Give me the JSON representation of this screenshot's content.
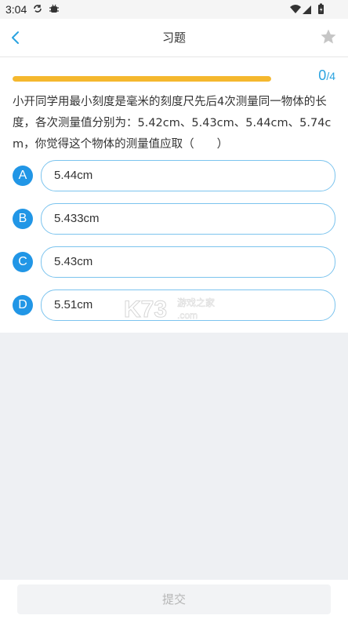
{
  "status_bar": {
    "time": "3:04"
  },
  "header": {
    "title": "习题"
  },
  "progress": {
    "current": "0",
    "separator": "/",
    "total": "4",
    "fill_fraction": 1.0
  },
  "question": {
    "text": "小开同学用最小刻度是毫米的刻度尺先后4次测量同一物体的长度，各次测量值分别为：5.42cm、5.43cm、5.44cm、5.74cm，你觉得这个物体的测量值应取（　　）"
  },
  "options": [
    {
      "letter": "A",
      "text": "5.44cm"
    },
    {
      "letter": "B",
      "text": "5.433cm"
    },
    {
      "letter": "C",
      "text": "5.43cm"
    },
    {
      "letter": "D",
      "text": "5.51cm"
    }
  ],
  "watermark": {
    "brand": "K73",
    "tagline": "游戏之家",
    "domain": ".com"
  },
  "footer": {
    "submit_label": "提交"
  },
  "colors": {
    "accent_blue": "#2196e6",
    "progress_yellow": "#f5b82e",
    "count_blue": "#2aa3e0"
  }
}
